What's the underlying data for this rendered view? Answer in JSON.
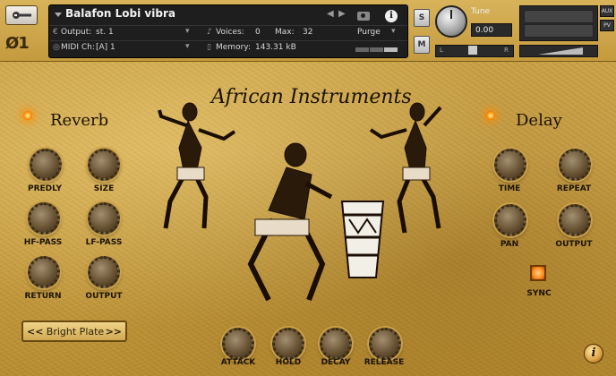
{
  "header": {
    "instrument_name": "Balafon Lobi vibra",
    "output_label": "Output:",
    "output_value": "st. 1",
    "voices_label": "Voices:",
    "voices_value": "0",
    "max_label": "Max:",
    "max_value": "32",
    "purge_label": "Purge",
    "midi_label": "MIDI Ch:",
    "midi_value": "[A]  1",
    "memory_label": "Memory:",
    "memory_value": "143.31 kB",
    "solo_label": "S",
    "mute_label": "M",
    "tune_label": "Tune",
    "tune_value": "0.00",
    "pan_left": "L",
    "pan_right": "R",
    "aux_label": "AUX",
    "pv_label": "PV",
    "logo_text": "Ø1"
  },
  "title": "African  Instruments",
  "reverb": {
    "label": "Reverb",
    "knobs": [
      "PREDLY",
      "SIZE",
      "HF-PASS",
      "LF-PASS",
      "RETURN",
      "OUTPUT"
    ]
  },
  "delay": {
    "label": "Delay",
    "knobs": [
      "TIME",
      "REPEAT",
      "PAN",
      "OUTPUT"
    ],
    "sync_label": "SYNC"
  },
  "envelope": {
    "knobs": [
      "ATTACK",
      "HOLD",
      "DECAY",
      "RELEASE"
    ]
  },
  "preset": {
    "prev": "<<",
    "name": "Bright Plate",
    "next": ">>"
  },
  "icons": {
    "wrench": "wrench-icon",
    "camera": "camera-icon",
    "info": "info-icon",
    "corner_info": "i"
  },
  "colors": {
    "background": "#c9a045",
    "lamp": "#ff8a00",
    "panel": "#1e1e1e"
  }
}
